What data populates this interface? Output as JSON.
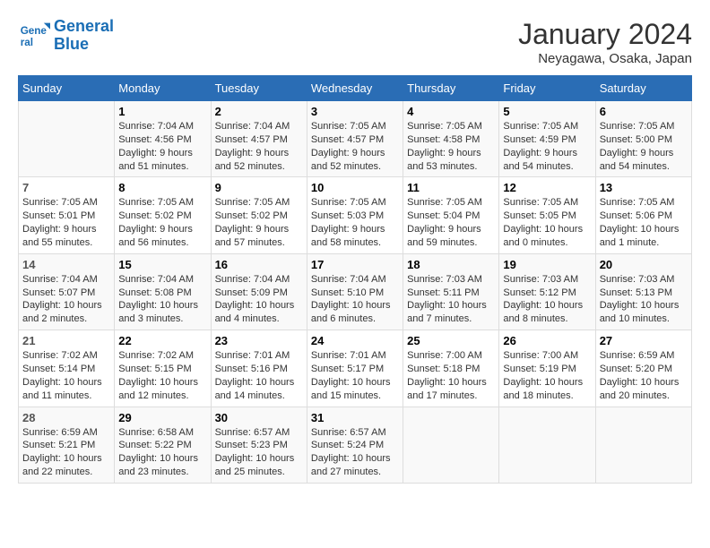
{
  "header": {
    "logo_line1": "General",
    "logo_line2": "Blue",
    "month": "January 2024",
    "location": "Neyagawa, Osaka, Japan"
  },
  "columns": [
    "Sunday",
    "Monday",
    "Tuesday",
    "Wednesday",
    "Thursday",
    "Friday",
    "Saturday"
  ],
  "weeks": [
    [
      {
        "day": "",
        "sunrise": "",
        "sunset": "",
        "daylight": ""
      },
      {
        "day": "1",
        "sunrise": "Sunrise: 7:04 AM",
        "sunset": "Sunset: 4:56 PM",
        "daylight": "Daylight: 9 hours and 51 minutes."
      },
      {
        "day": "2",
        "sunrise": "Sunrise: 7:04 AM",
        "sunset": "Sunset: 4:57 PM",
        "daylight": "Daylight: 9 hours and 52 minutes."
      },
      {
        "day": "3",
        "sunrise": "Sunrise: 7:05 AM",
        "sunset": "Sunset: 4:57 PM",
        "daylight": "Daylight: 9 hours and 52 minutes."
      },
      {
        "day": "4",
        "sunrise": "Sunrise: 7:05 AM",
        "sunset": "Sunset: 4:58 PM",
        "daylight": "Daylight: 9 hours and 53 minutes."
      },
      {
        "day": "5",
        "sunrise": "Sunrise: 7:05 AM",
        "sunset": "Sunset: 4:59 PM",
        "daylight": "Daylight: 9 hours and 54 minutes."
      },
      {
        "day": "6",
        "sunrise": "Sunrise: 7:05 AM",
        "sunset": "Sunset: 5:00 PM",
        "daylight": "Daylight: 9 hours and 54 minutes."
      }
    ],
    [
      {
        "day": "7",
        "sunrise": "Sunrise: 7:05 AM",
        "sunset": "Sunset: 5:01 PM",
        "daylight": "Daylight: 9 hours and 55 minutes."
      },
      {
        "day": "8",
        "sunrise": "Sunrise: 7:05 AM",
        "sunset": "Sunset: 5:02 PM",
        "daylight": "Daylight: 9 hours and 56 minutes."
      },
      {
        "day": "9",
        "sunrise": "Sunrise: 7:05 AM",
        "sunset": "Sunset: 5:02 PM",
        "daylight": "Daylight: 9 hours and 57 minutes."
      },
      {
        "day": "10",
        "sunrise": "Sunrise: 7:05 AM",
        "sunset": "Sunset: 5:03 PM",
        "daylight": "Daylight: 9 hours and 58 minutes."
      },
      {
        "day": "11",
        "sunrise": "Sunrise: 7:05 AM",
        "sunset": "Sunset: 5:04 PM",
        "daylight": "Daylight: 9 hours and 59 minutes."
      },
      {
        "day": "12",
        "sunrise": "Sunrise: 7:05 AM",
        "sunset": "Sunset: 5:05 PM",
        "daylight": "Daylight: 10 hours and 0 minutes."
      },
      {
        "day": "13",
        "sunrise": "Sunrise: 7:05 AM",
        "sunset": "Sunset: 5:06 PM",
        "daylight": "Daylight: 10 hours and 1 minute."
      }
    ],
    [
      {
        "day": "14",
        "sunrise": "Sunrise: 7:04 AM",
        "sunset": "Sunset: 5:07 PM",
        "daylight": "Daylight: 10 hours and 2 minutes."
      },
      {
        "day": "15",
        "sunrise": "Sunrise: 7:04 AM",
        "sunset": "Sunset: 5:08 PM",
        "daylight": "Daylight: 10 hours and 3 minutes."
      },
      {
        "day": "16",
        "sunrise": "Sunrise: 7:04 AM",
        "sunset": "Sunset: 5:09 PM",
        "daylight": "Daylight: 10 hours and 4 minutes."
      },
      {
        "day": "17",
        "sunrise": "Sunrise: 7:04 AM",
        "sunset": "Sunset: 5:10 PM",
        "daylight": "Daylight: 10 hours and 6 minutes."
      },
      {
        "day": "18",
        "sunrise": "Sunrise: 7:03 AM",
        "sunset": "Sunset: 5:11 PM",
        "daylight": "Daylight: 10 hours and 7 minutes."
      },
      {
        "day": "19",
        "sunrise": "Sunrise: 7:03 AM",
        "sunset": "Sunset: 5:12 PM",
        "daylight": "Daylight: 10 hours and 8 minutes."
      },
      {
        "day": "20",
        "sunrise": "Sunrise: 7:03 AM",
        "sunset": "Sunset: 5:13 PM",
        "daylight": "Daylight: 10 hours and 10 minutes."
      }
    ],
    [
      {
        "day": "21",
        "sunrise": "Sunrise: 7:02 AM",
        "sunset": "Sunset: 5:14 PM",
        "daylight": "Daylight: 10 hours and 11 minutes."
      },
      {
        "day": "22",
        "sunrise": "Sunrise: 7:02 AM",
        "sunset": "Sunset: 5:15 PM",
        "daylight": "Daylight: 10 hours and 12 minutes."
      },
      {
        "day": "23",
        "sunrise": "Sunrise: 7:01 AM",
        "sunset": "Sunset: 5:16 PM",
        "daylight": "Daylight: 10 hours and 14 minutes."
      },
      {
        "day": "24",
        "sunrise": "Sunrise: 7:01 AM",
        "sunset": "Sunset: 5:17 PM",
        "daylight": "Daylight: 10 hours and 15 minutes."
      },
      {
        "day": "25",
        "sunrise": "Sunrise: 7:00 AM",
        "sunset": "Sunset: 5:18 PM",
        "daylight": "Daylight: 10 hours and 17 minutes."
      },
      {
        "day": "26",
        "sunrise": "Sunrise: 7:00 AM",
        "sunset": "Sunset: 5:19 PM",
        "daylight": "Daylight: 10 hours and 18 minutes."
      },
      {
        "day": "27",
        "sunrise": "Sunrise: 6:59 AM",
        "sunset": "Sunset: 5:20 PM",
        "daylight": "Daylight: 10 hours and 20 minutes."
      }
    ],
    [
      {
        "day": "28",
        "sunrise": "Sunrise: 6:59 AM",
        "sunset": "Sunset: 5:21 PM",
        "daylight": "Daylight: 10 hours and 22 minutes."
      },
      {
        "day": "29",
        "sunrise": "Sunrise: 6:58 AM",
        "sunset": "Sunset: 5:22 PM",
        "daylight": "Daylight: 10 hours and 23 minutes."
      },
      {
        "day": "30",
        "sunrise": "Sunrise: 6:57 AM",
        "sunset": "Sunset: 5:23 PM",
        "daylight": "Daylight: 10 hours and 25 minutes."
      },
      {
        "day": "31",
        "sunrise": "Sunrise: 6:57 AM",
        "sunset": "Sunset: 5:24 PM",
        "daylight": "Daylight: 10 hours and 27 minutes."
      },
      {
        "day": "",
        "sunrise": "",
        "sunset": "",
        "daylight": ""
      },
      {
        "day": "",
        "sunrise": "",
        "sunset": "",
        "daylight": ""
      },
      {
        "day": "",
        "sunrise": "",
        "sunset": "",
        "daylight": ""
      }
    ]
  ]
}
